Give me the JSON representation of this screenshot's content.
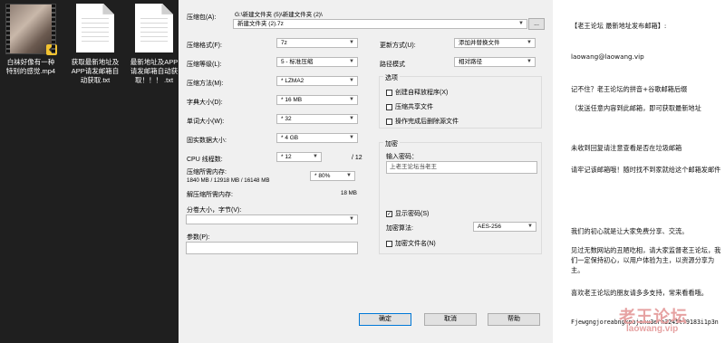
{
  "desktop": {
    "files": [
      {
        "name": "白袜好像有一种特别的感觉.mp4",
        "type": "video"
      },
      {
        "name": "获取最新地址及APP请发邮箱自动获取.txt",
        "type": "text"
      },
      {
        "name": "最新地址及APP请发邮箱自动获取！！！ .txt",
        "type": "text"
      }
    ]
  },
  "dialog": {
    "archive_label": "压缩包(A):",
    "archive_path": "G:\\新建文件夹 (5)\\新建文件夹 (2)\\",
    "archive_name": "新建文件夹 (2).7z",
    "browse_label": "...",
    "format_label": "压缩格式(F):",
    "format_value": "7z",
    "level_label": "压缩等级(L):",
    "level_value": "5 - 标准压缩",
    "method_label": "压缩方法(M):",
    "method_value": "* LZMA2",
    "dict_label": "字典大小(D):",
    "dict_value": "* 16 MB",
    "word_label": "单词大小(W):",
    "word_value": "* 32",
    "solid_label": "固实数据大小:",
    "solid_value": "* 4 GB",
    "cpu_label": "CPU 线程数:",
    "cpu_value": "* 12",
    "cpu_max": "/ 12",
    "mem_comp_label": "压缩所需内存:",
    "mem_comp_value": "1840 MB / 12918 MB / 16148 MB",
    "mem_percent": "* 80%",
    "mem_decomp_label": "解压缩所需内存:",
    "mem_decomp_value": "18 MB",
    "split_label": "分卷大小，字节(V):",
    "split_value": "",
    "params_label": "参数(P):",
    "params_value": "",
    "update_label": "更新方式(U):",
    "update_value": "添加并替换文件",
    "path_label": "路径模式",
    "path_value": "相对路径",
    "options_title": "选项",
    "opt_sfx": "创建自释放程序(X)",
    "opt_shared": "压缩共享文件",
    "opt_delete": "操作完成后删除源文件",
    "encrypt_title": "加密",
    "pwd_label": "输入密码：",
    "pwd_value": "上老王论坛当老王",
    "show_pwd": "显示密码(S)",
    "show_pwd_check": "✓",
    "enc_method_label": "加密算法:",
    "enc_method_value": "AES-256",
    "enc_names": "加密文件名(N)",
    "ok": "确定",
    "cancel": "取消",
    "help": "帮助"
  },
  "notes": {
    "line1": "【老王论坛 最新地址发布邮箱】:",
    "line2": "laowang@laowang.vip",
    "line3": "记不住？老王论坛的拼音+谷歌邮箱后缀",
    "line4": "（发送任意内容到此邮箱，即可获取最新地址",
    "line5": "未收到回复请注意查看是否在垃圾邮箱",
    "line6": "请牢记该邮箱哦！随时找不到家就给这个邮箱发邮件",
    "line7": "我们的初心就是让大家免费分享、交流。",
    "line8": "见过无数网站的丑陋吃相，请大家监督老王论坛，我们一定保持初心，以用户体验为主，以资源分享为主。",
    "line9": "喜欢老王论坛的朋友请多多支持，常来看看哦。",
    "line10": "Fjewgngjoreabngkpojehu3erh3245t79183i1p3n",
    "watermark_cn": "老王论坛",
    "watermark_en": "laowang.vip"
  }
}
